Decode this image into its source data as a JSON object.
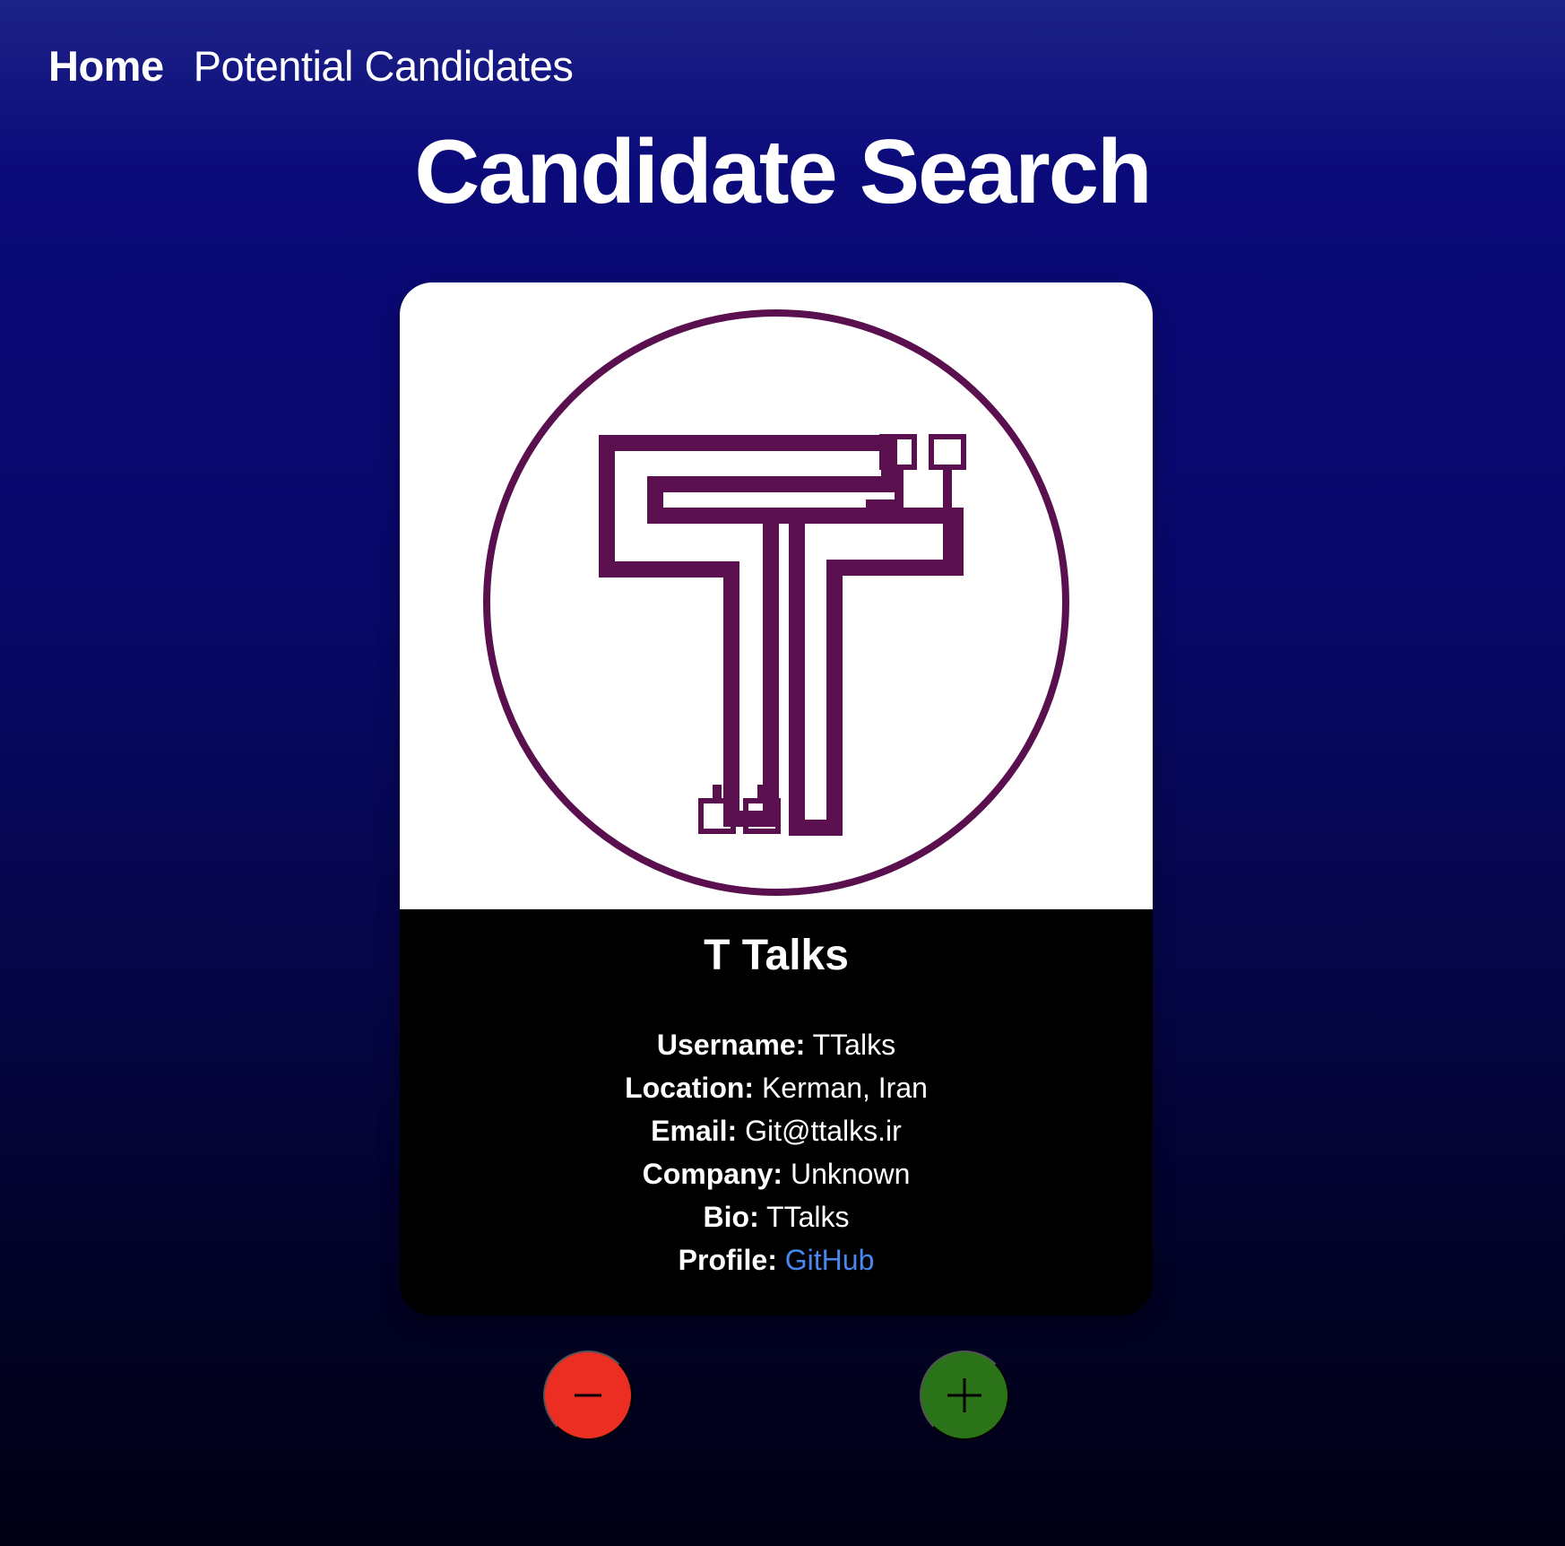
{
  "app": {
    "title": "Candidate Search"
  },
  "nav": {
    "items": [
      {
        "label": "Home",
        "active": true
      },
      {
        "label": "Potential Candidates",
        "active": false
      }
    ]
  },
  "candidate": {
    "avatar_icon": "t-logo-icon",
    "name": "T Talks",
    "fields": [
      {
        "label": "Username:",
        "value": "TTalks"
      },
      {
        "label": "Location:",
        "value": "Kerman, Iran"
      },
      {
        "label": "Email:",
        "value": "Git@ttalks.ir"
      },
      {
        "label": "Company:",
        "value": "Unknown"
      },
      {
        "label": "Bio:",
        "value": "TTalks"
      }
    ],
    "profile": {
      "label": "Profile:",
      "link_text": "GitHub"
    }
  },
  "actions": {
    "reject": {
      "icon": "minus-icon",
      "color": "#ec2e22"
    },
    "accept": {
      "icon": "plus-icon",
      "color": "#2a7318"
    }
  },
  "colors": {
    "background_top": "#1c2286",
    "background_bottom": "#000014",
    "card_background": "#000000",
    "link": "#4a86f0",
    "logo_stroke": "#5a0f4e"
  }
}
